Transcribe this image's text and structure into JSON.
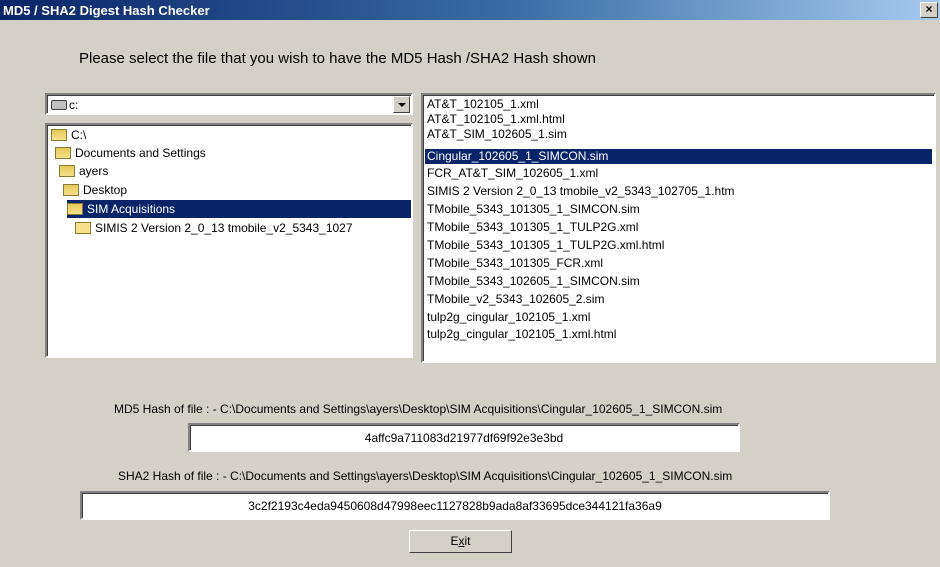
{
  "window": {
    "title": "MD5 / SHA2 Digest Hash Checker",
    "close_label": "×"
  },
  "prompt": "Please select the file that you wish to have the MD5 Hash /SHA2 Hash shown",
  "drive": {
    "label": "c:",
    "icon": "drive-icon"
  },
  "tree": [
    {
      "label": "C:\\",
      "selected": false
    },
    {
      "label": "Documents and Settings",
      "selected": false
    },
    {
      "label": "ayers",
      "selected": false
    },
    {
      "label": "Desktop",
      "selected": false
    },
    {
      "label": "SIM Acquisitions",
      "selected": true
    },
    {
      "label": "SIMIS 2 Version 2_0_13 tmobile_v2_5343_1027",
      "selected": false
    }
  ],
  "files": [
    "AT&T_102105_1.xml",
    "AT&T_102105_1.xml.html",
    "AT&T_SIM_102605_1.sim",
    "Cingular_102605_1_SIMCON.sim",
    "FCR_AT&T_SIM_102605_1.xml",
    "SIMIS 2 Version 2_0_13 tmobile_v2_5343_102705_1.htm",
    "TMobile_5343_101305_1_SIMCON.sim",
    "TMobile_5343_101305_1_TULP2G.xml",
    "TMobile_5343_101305_1_TULP2G.xml.html",
    "TMobile_5343_101305_FCR.xml",
    "TMobile_5343_102605_1_SIMCON.sim",
    "TMobile_v2_5343_102605_2.sim",
    "tulp2g_cingular_102105_1.xml",
    "tulp2g_cingular_102105_1.xml.html"
  ],
  "selected_file_index": 3,
  "md5": {
    "caption": "MD5 Hash of file : - C:\\Documents and Settings\\ayers\\Desktop\\SIM Acquisitions\\Cingular_102605_1_SIMCON.sim",
    "value": "4affc9a711083d21977df69f92e3e3bd"
  },
  "sha2": {
    "caption": "SHA2 Hash of file : - C:\\Documents and Settings\\ayers\\Desktop\\SIM Acquisitions\\Cingular_102605_1_SIMCON.sim",
    "value": "3c2f2193c4eda9450608d47998eec1127828b9ada8af33695dce344121fa36a9"
  },
  "exit_button": {
    "label_pre": "E",
    "label_ul": "x",
    "label_post": "it"
  },
  "colors": {
    "selection": "#0a246a",
    "face": "#d4d0c8",
    "title_start": "#0a246a",
    "title_end": "#a6caf0"
  }
}
